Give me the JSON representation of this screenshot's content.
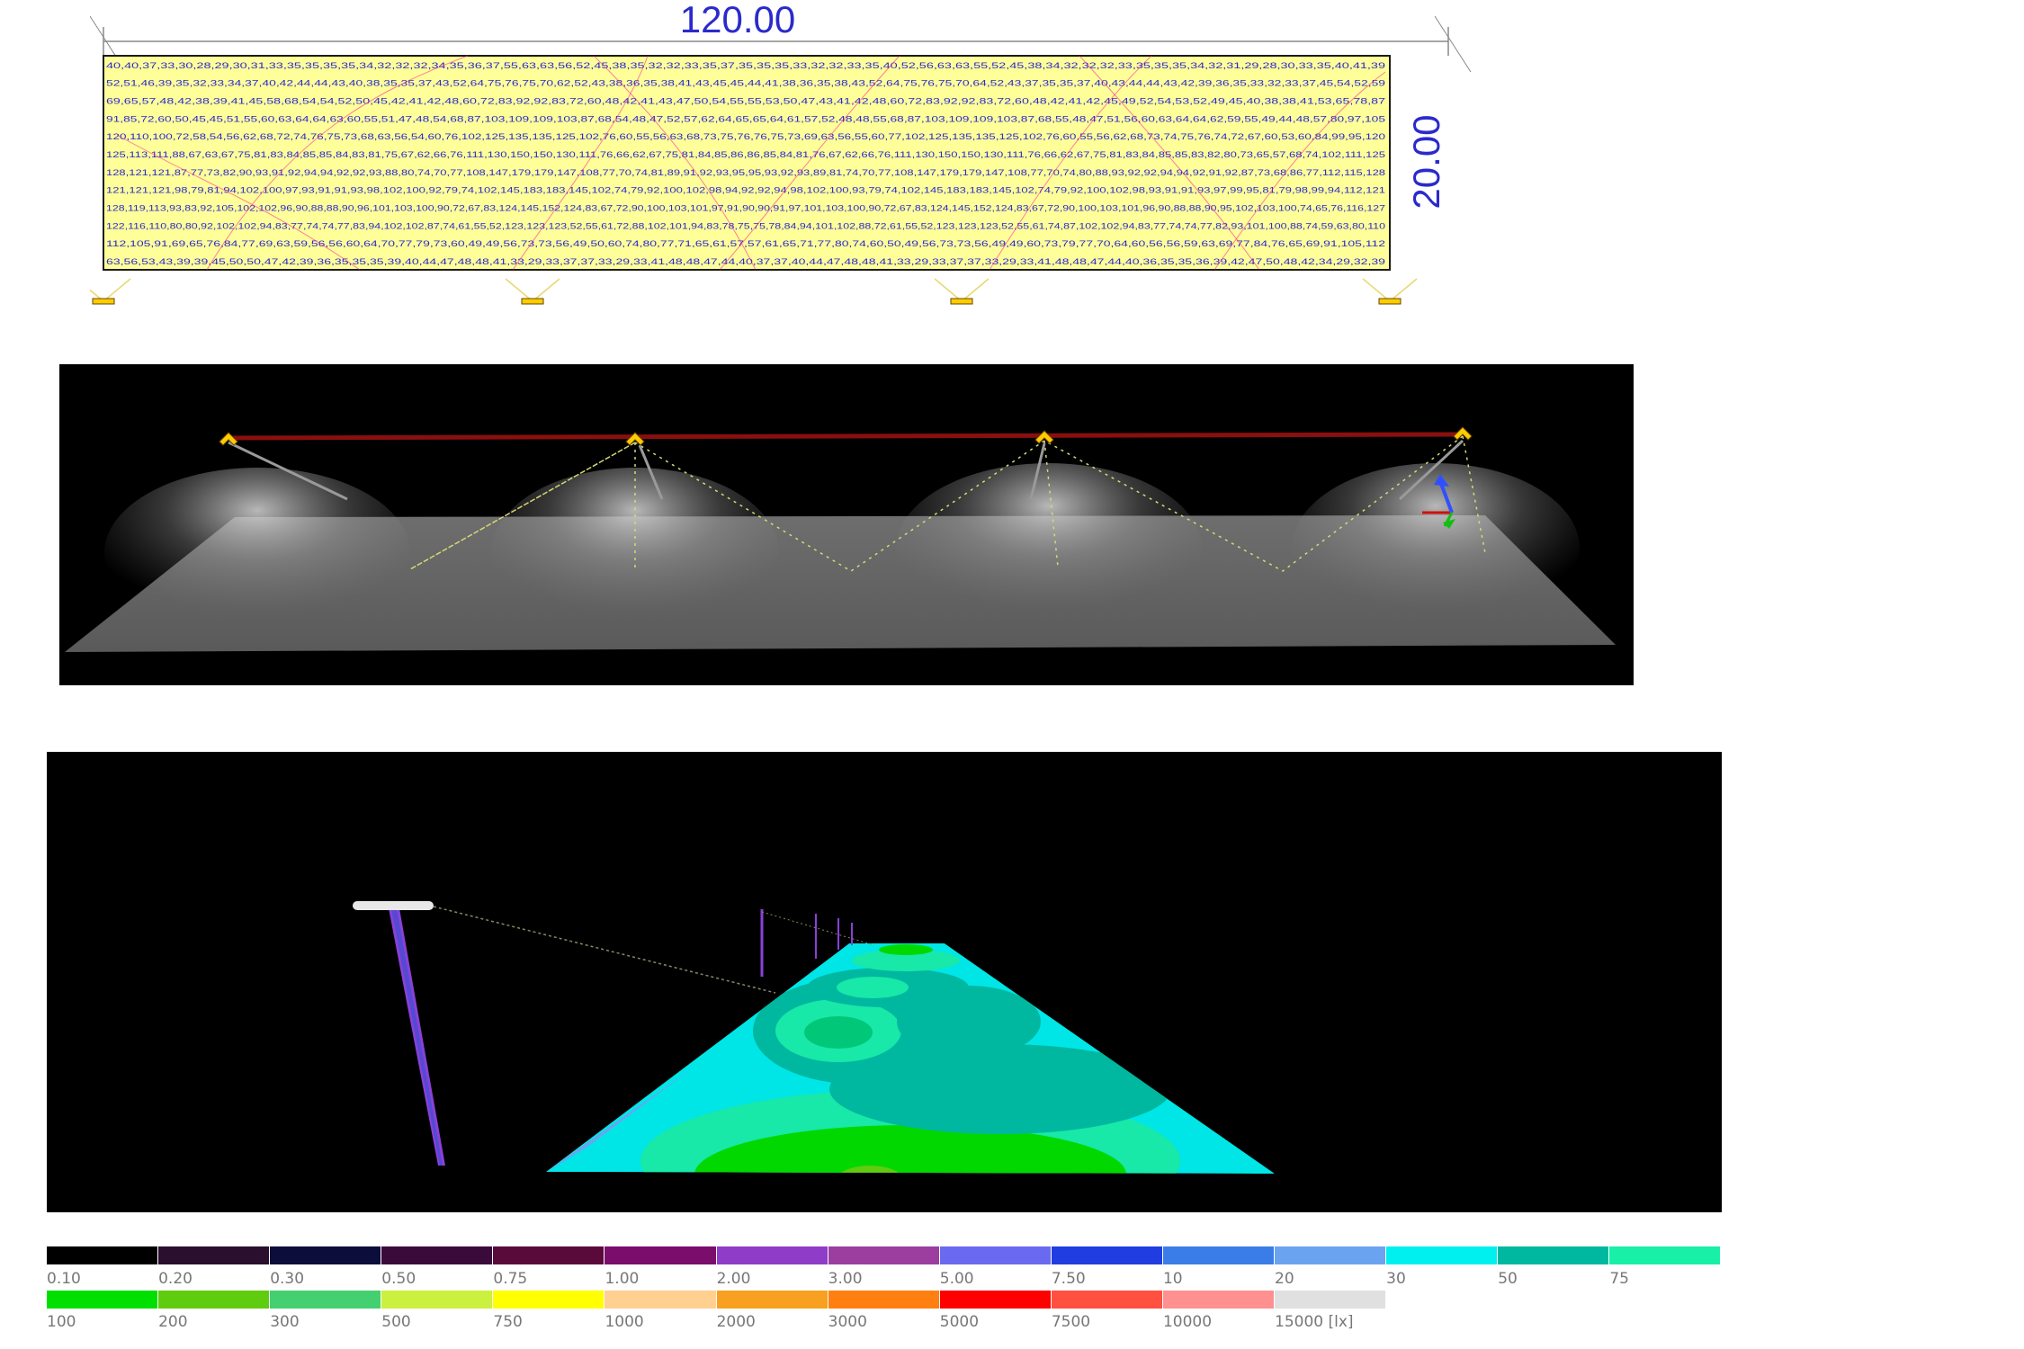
{
  "plan": {
    "width_label": "120.00",
    "height_label": "20.00",
    "luminaires": 4,
    "grid_rows": [
      "40,40,37,33,30,28,29,30,31,33,35,35,35,35,34,32,32,32,34,35,36,37,55,63,63,56,52,45,38,35,32,32,33,35,37,35,35,35,33,32,32,33,35,40,52,56,63,63,55,52,45,38,34,32,32,32,33,35,35,35,34,32,31,29,28,30,33,35,40,41,39",
      "52,51,46,39,35,32,33,34,37,40,42,44,44,43,40,38,35,35,37,43,52,64,75,76,75,70,62,52,43,38,36,35,38,41,43,45,45,44,41,38,36,35,38,43,52,64,75,76,75,70,64,52,43,37,35,35,37,40,43,44,44,43,42,39,36,35,33,32,33,37,45,54,52,59",
      "69,65,57,48,42,38,39,41,45,58,68,54,54,52,50,45,42,41,42,48,60,72,83,92,92,83,72,60,48,42,41,43,47,50,54,55,55,53,50,47,43,41,42,48,60,72,83,92,92,83,72,60,48,42,41,42,45,49,52,54,53,52,49,45,40,38,38,41,53,65,78,87",
      "91,85,72,60,50,45,45,51,55,60,63,64,64,63,60,55,51,47,48,54,68,87,103,109,109,103,87,68,54,48,47,52,57,62,64,65,65,64,61,57,52,48,48,55,68,87,103,109,109,103,87,68,55,48,47,51,56,60,63,64,64,62,59,55,49,44,48,57,80,97,105",
      "120,110,100,72,58,54,56,62,68,72,74,76,75,73,68,63,56,54,60,76,102,125,135,135,125,102,76,60,55,56,63,68,73,75,76,76,75,73,69,63,56,55,60,77,102,125,135,135,125,102,76,60,55,56,62,68,73,74,75,76,74,72,67,60,53,60,84,99,95,120",
      "125,113,111,88,67,63,67,75,81,83,84,85,85,84,83,81,75,67,62,66,76,111,130,150,150,130,111,76,66,62,67,75,81,84,85,86,86,85,84,81,76,67,62,66,76,111,130,150,150,130,111,76,66,62,67,75,81,83,84,85,85,83,82,80,73,65,57,68,74,102,111,125",
      "128,121,121,87,77,73,82,90,93,91,92,94,94,92,92,93,88,80,74,70,77,108,147,179,179,147,108,77,70,74,81,89,91,92,93,95,95,93,92,93,89,81,74,70,77,108,147,179,179,147,108,77,70,74,80,88,93,92,92,94,94,92,91,92,87,73,68,86,77,112,115,128",
      "121,121,121,98,79,81,94,102,100,97,93,91,91,93,98,102,100,92,79,74,102,145,183,183,145,102,74,79,92,100,102,98,94,92,92,94,98,102,100,93,79,74,102,145,183,183,145,102,74,79,92,100,102,98,93,91,91,93,97,99,95,81,79,98,99,94,112,121",
      "128,119,113,93,83,92,105,102,102,96,90,88,88,90,96,101,103,100,90,72,67,83,124,145,152,124,83,67,72,90,100,103,101,97,91,90,90,91,97,101,103,100,90,72,67,83,124,145,152,124,83,67,72,90,100,103,101,96,90,88,88,90,95,102,103,100,74,65,76,116,127",
      "122,116,110,80,80,92,102,102,94,83,77,74,74,77,83,94,102,102,87,74,61,55,52,123,123,123,52,55,61,72,88,102,101,94,83,78,75,75,78,84,94,101,102,88,72,61,55,52,123,123,123,52,55,61,74,87,102,102,94,83,77,74,74,77,82,93,101,100,88,74,59,63,80,110",
      "112,105,91,69,65,76,84,77,69,63,59,56,56,60,64,70,77,79,73,60,49,49,56,73,73,56,49,50,60,74,80,77,71,65,61,57,57,61,65,71,77,80,74,60,50,49,56,73,73,56,49,49,60,73,79,77,70,64,60,56,56,59,63,69,77,84,76,65,69,91,105,112",
      "63,56,53,43,39,39,45,50,50,47,42,39,36,35,35,35,39,40,44,47,48,48,41,33,29,33,37,37,33,29,33,41,48,48,47,44,40,37,37,40,44,47,48,48,41,33,29,33,37,37,33,29,33,41,48,48,47,44,40,36,35,35,36,39,42,47,50,48,42,34,29,32,39"
    ]
  },
  "legend": {
    "row1": {
      "labels": [
        "0.10",
        "0.20",
        "0.30",
        "0.50",
        "0.75",
        "1.00",
        "2.00",
        "3.00",
        "5.00",
        "7.50",
        "10",
        "20",
        "30",
        "50",
        "75"
      ],
      "colors": [
        "#000000",
        "#2a0f2e",
        "#0d0d3b",
        "#3a0a3a",
        "#5a0a3a",
        "#7b0d6b",
        "#8f3cc9",
        "#9c3ea0",
        "#6a6af0",
        "#1f3de0",
        "#3a7de8",
        "#6aa4f0",
        "#00f0f0",
        "#00b8a0",
        "#18f0a8"
      ]
    },
    "row2": {
      "labels": [
        "100",
        "200",
        "300",
        "500",
        "750",
        "1000",
        "2000",
        "3000",
        "5000",
        "7500",
        "10000",
        "15000 [lx]"
      ],
      "colors": [
        "#00e000",
        "#60cc10",
        "#44d070",
        "#ccf040",
        "#ffff00",
        "#ffd090",
        "#f8a020",
        "#ff8010",
        "#ff0000",
        "#ff5040",
        "#ff9090",
        "#e0e0e0"
      ]
    }
  },
  "colors": {
    "plan_lines": "#1a1a1a",
    "plan_fill": "#ffff99",
    "dimension": "#2a2acc",
    "isolines": "#ff1493",
    "luminaire": "#ffcc00"
  }
}
